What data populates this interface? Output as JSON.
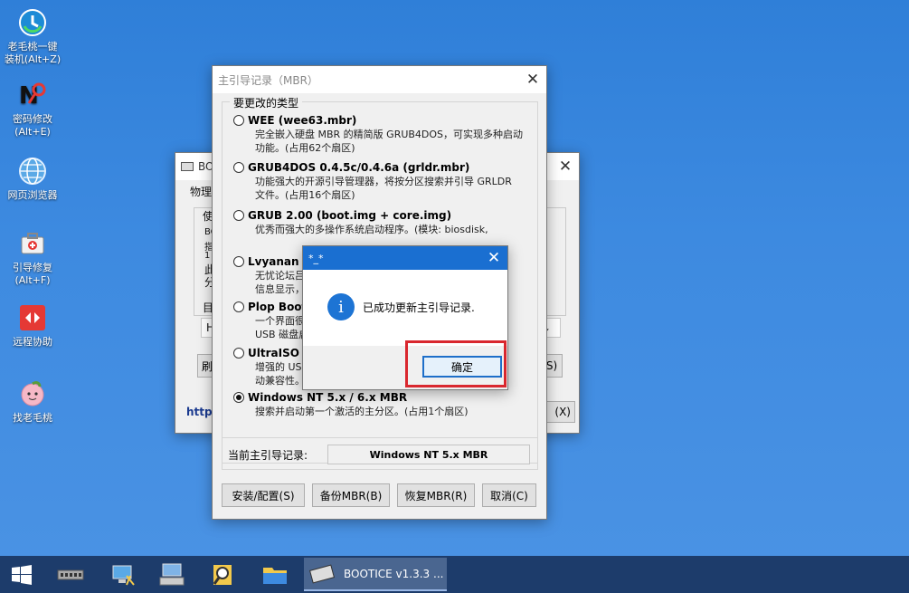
{
  "desktop": {
    "icons": [
      {
        "label": "老毛桃一键\n装机(Alt+Z)",
        "icon": "one-click-install-icon"
      },
      {
        "label": "密码修改\n(Alt+E)",
        "icon": "password-change-icon"
      },
      {
        "label": "网页浏览器",
        "icon": "web-browser-icon"
      },
      {
        "label": "引导修复\n(Alt+F)",
        "icon": "boot-repair-icon"
      },
      {
        "label": "远程协助",
        "icon": "remote-assist-icon"
      },
      {
        "label": "找老毛桃",
        "icon": "find-laomaotao-icon"
      }
    ]
  },
  "bootice": {
    "title": "BOO",
    "tab_label": "物理",
    "left_chars": [
      "使",
      "BO",
      "指",
      "1",
      "此",
      "分",
      "目",
      "H",
      "刷"
    ],
    "right_fragments": [
      "S)",
      "(X)"
    ],
    "url_text": "http:"
  },
  "mbr": {
    "title": "主引导记录（MBR）",
    "group_label": "要更改的类型",
    "options": [
      {
        "name": "WEE (wee63.mbr)",
        "desc": "完全嵌入硬盘 MBR 的精简版 GRUB4DOS，可实现多种启动\n功能。(占用62个扇区)",
        "selected": false
      },
      {
        "name": "GRUB4DOS 0.4.5c/0.4.6a (grldr.mbr)",
        "desc": "功能强大的开源引导管理器，将按分区搜索并引导 GRLDR\n文件。(占用16个扇区)",
        "selected": false
      },
      {
        "name": "GRUB 2.00 (boot.img + core.img)",
        "desc": "优秀而强大的多操作系统启动程序。(模块: biosdisk,\npart_msdos,fat,exfat,ext2,search_fs_file, 63个扇区)",
        "selected": false
      },
      {
        "name": "Lvyanan 1:",
        "desc": "无忧论坛吕\n信息显示，",
        "selected": false
      },
      {
        "name": "Plop Boot M",
        "desc": "一个界面很\nUSB 磁盘启",
        "selected": false
      },
      {
        "name": "UltraISO US",
        "desc": "增强的 USB+\n动兼容性。",
        "selected": false
      },
      {
        "name": "Windows NT 5.x / 6.x MBR",
        "desc": "搜索并启动第一个激活的主分区。(占用1个扇区)",
        "selected": true
      }
    ],
    "current_label": "当前主引导记录:",
    "current_value": "Windows NT 5.x MBR",
    "buttons": {
      "install": "安装/配置(S)",
      "backup": "备份MBR(B)",
      "restore": "恢复MBR(R)",
      "cancel": "取消(C)"
    }
  },
  "message": {
    "title": "*_*",
    "text": "已成功更新主引导记录.",
    "ok": "确定"
  },
  "taskbar": {
    "active_task": "BOOTICE v1.3.3 ..."
  },
  "colors": {
    "highlight_box": "#d9272e",
    "title_blue": "#1a6fd1",
    "info_blue": "#1d74d4"
  }
}
